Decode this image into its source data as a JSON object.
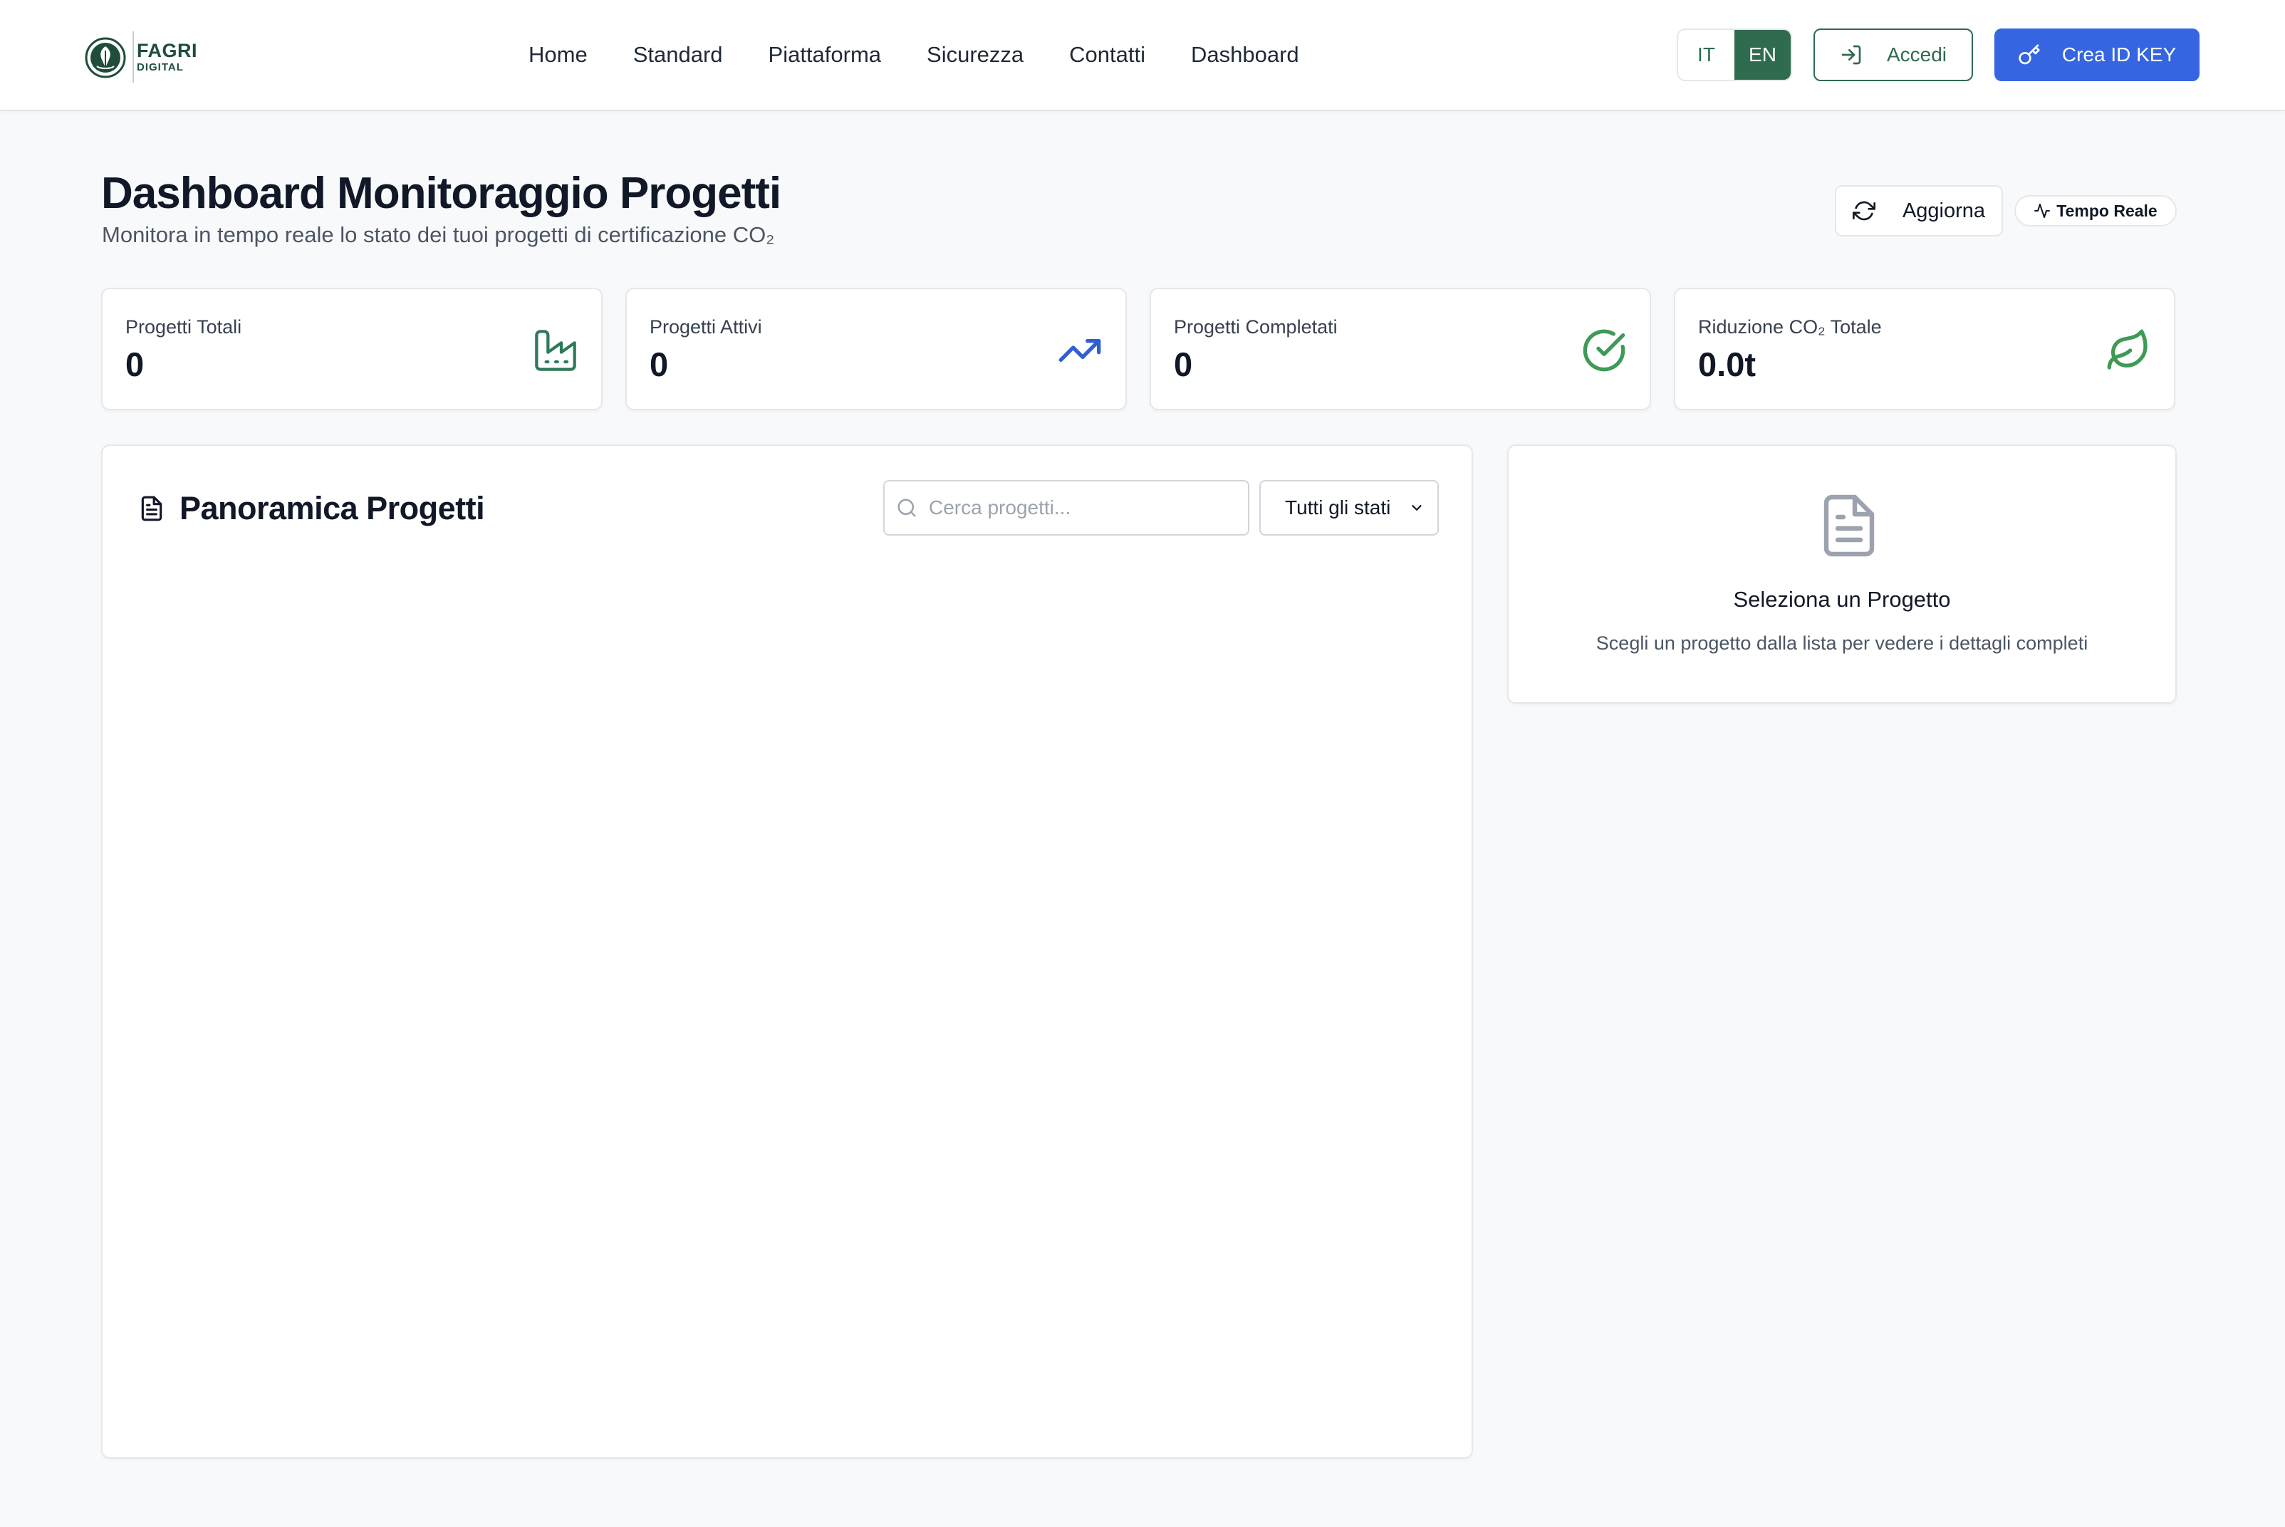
{
  "brand": {
    "line1": "FAGRI",
    "line2": "DIGITAL",
    "color": "#1f4d3a"
  },
  "nav": {
    "links": [
      "Home",
      "Standard",
      "Piattaforma",
      "Sicurezza",
      "Contatti",
      "Dashboard"
    ],
    "lang": {
      "it": "IT",
      "en": "EN",
      "active": "EN"
    },
    "login_label": "Accedi",
    "create_key_label": "Crea ID KEY"
  },
  "header": {
    "title": "Dashboard Monitoraggio Progetti",
    "subtitle": "Monitora in tempo reale lo stato dei tuoi progetti di certificazione CO₂",
    "refresh_label": "Aggiorna",
    "realtime_badge": "Tempo Reale"
  },
  "stats": [
    {
      "label": "Progetti Totali",
      "value": "0",
      "icon": "factory-icon",
      "color": "#2f7a58"
    },
    {
      "label": "Progetti Attivi",
      "value": "0",
      "icon": "trending-up-icon",
      "color": "#2f5fd6"
    },
    {
      "label": "Progetti Completati",
      "value": "0",
      "icon": "check-circle-icon",
      "color": "#3e9a55"
    },
    {
      "label": "Riduzione CO₂ Totale",
      "value": "0.0t",
      "icon": "leaf-icon",
      "color": "#3e9a55"
    }
  ],
  "projects": {
    "title": "Panoramica Progetti",
    "search_placeholder": "Cerca progetti...",
    "search_value": "",
    "status_filter": "Tutti gli stati"
  },
  "detail": {
    "title": "Seleziona un Progetto",
    "description": "Scegli un progetto dalla lista per vedere i dettagli completi"
  },
  "colors": {
    "primary_green": "#2f6b4f",
    "primary_blue": "#3565e0",
    "background": "#f8f9fb"
  }
}
